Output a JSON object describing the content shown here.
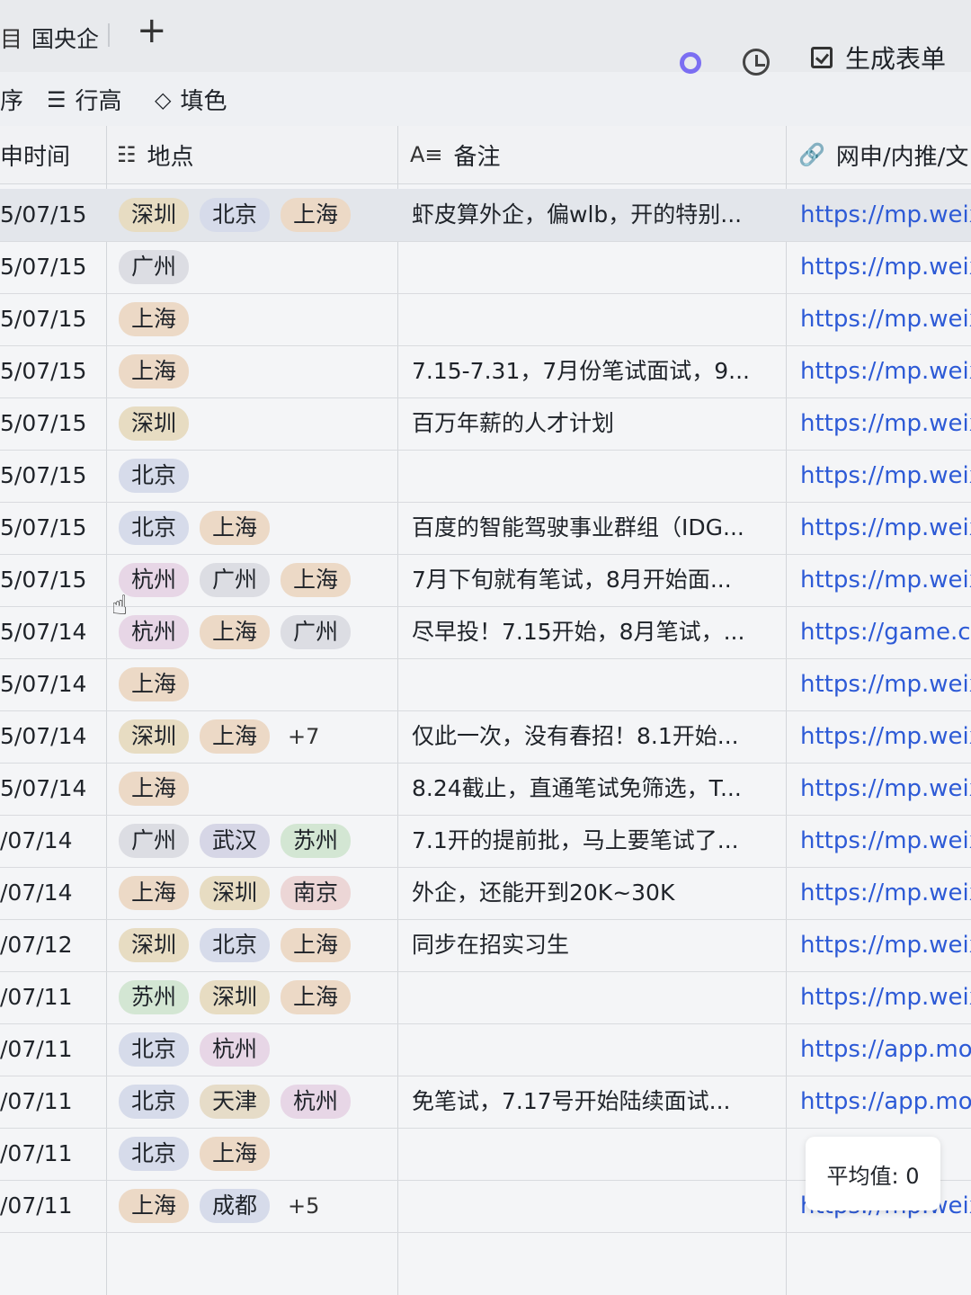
{
  "tabs": {
    "active": "国央企",
    "add": "+"
  },
  "toolbar": {
    "sort": "序",
    "row_height": "行高",
    "fill": "填色",
    "generate_form": "生成表单"
  },
  "columns": {
    "date": "申时间",
    "location": "地点",
    "note": "备注",
    "link": "网申/内推/文"
  },
  "tag_colors": {
    "深圳": "#e7dcc2",
    "北京": "#d6dbea",
    "上海": "#ecd9c6",
    "广州": "#dcdde3",
    "杭州": "#e7d6e6",
    "武汉": "#d6d6e6",
    "苏州": "#d3e6d3",
    "南京": "#ecd6d6",
    "天津": "#e6dcc8",
    "成都": "#d6dbea"
  },
  "rows": [
    {
      "date": "5/07/15",
      "tags": [
        "深圳",
        "北京",
        "上海"
      ],
      "more": "",
      "note": "虾皮算外企，偏wlb，开的特别...",
      "link": "https://mp.weixin"
    },
    {
      "date": "5/07/15",
      "tags": [
        "广州"
      ],
      "more": "",
      "note": "",
      "link": "https://mp.weixin"
    },
    {
      "date": "5/07/15",
      "tags": [
        "上海"
      ],
      "more": "",
      "note": "",
      "link": "https://mp.weixin"
    },
    {
      "date": "5/07/15",
      "tags": [
        "上海"
      ],
      "more": "",
      "note": "7.15-7.31，7月份笔试面试，9...",
      "link": "https://mp.weixin"
    },
    {
      "date": "5/07/15",
      "tags": [
        "深圳"
      ],
      "more": "",
      "note": "百万年薪的人才计划",
      "link": "https://mp.weixin"
    },
    {
      "date": "5/07/15",
      "tags": [
        "北京"
      ],
      "more": "",
      "note": "",
      "link": "https://mp.weixin"
    },
    {
      "date": "5/07/15",
      "tags": [
        "北京",
        "上海"
      ],
      "more": "",
      "note": "百度的智能驾驶事业群组（IDG...",
      "link": "https://mp.weixin"
    },
    {
      "date": "5/07/15",
      "tags": [
        "杭州",
        "广州",
        "上海"
      ],
      "more": "",
      "note": "7月下旬就有笔试，8月开始面...",
      "link": "https://mp.weixin"
    },
    {
      "date": "5/07/14",
      "tags": [
        "杭州",
        "上海",
        "广州"
      ],
      "more": "",
      "note": "尽早投！7.15开始，8月笔试，...",
      "link": "https://game.c"
    },
    {
      "date": "5/07/14",
      "tags": [
        "上海"
      ],
      "more": "",
      "note": "",
      "link": "https://mp.weixin"
    },
    {
      "date": "5/07/14",
      "tags": [
        "深圳",
        "上海"
      ],
      "more": "+7",
      "note": "仅此一次，没有春招！8.1开始...",
      "link": "https://mp.weixin"
    },
    {
      "date": "5/07/14",
      "tags": [
        "上海"
      ],
      "more": "",
      "note": "8.24截止，直通笔试免筛选，T...",
      "link": "https://mp.weixin"
    },
    {
      "date": "/07/14",
      "tags": [
        "广州",
        "武汉",
        "苏州"
      ],
      "more": "",
      "note": "7.1开的提前批，马上要笔试了...",
      "link": "https://mp.weixin"
    },
    {
      "date": "/07/14",
      "tags": [
        "上海",
        "深圳",
        "南京"
      ],
      "more": "",
      "note": "外企，还能开到20K~30K",
      "link": "https://mp.weixin"
    },
    {
      "date": "/07/12",
      "tags": [
        "深圳",
        "北京",
        "上海"
      ],
      "more": "",
      "note": "同步在招实习生",
      "link": "https://mp.weixin"
    },
    {
      "date": "/07/11",
      "tags": [
        "苏州",
        "深圳",
        "上海"
      ],
      "more": "",
      "note": "",
      "link": "https://mp.weixin"
    },
    {
      "date": "/07/11",
      "tags": [
        "北京",
        "杭州"
      ],
      "more": "",
      "note": "",
      "link": "https://app.mo"
    },
    {
      "date": "/07/11",
      "tags": [
        "北京",
        "天津",
        "杭州"
      ],
      "more": "",
      "note": "免笔试，7.17号开始陆续面试...",
      "link": "https://app.mo"
    },
    {
      "date": "/07/11",
      "tags": [
        "北京",
        "上海"
      ],
      "more": "",
      "note": "",
      "link": ""
    },
    {
      "date": "/07/11",
      "tags": [
        "上海",
        "成都"
      ],
      "more": "+5",
      "note": "",
      "link": "https://mp.weixin"
    }
  ],
  "footer": {
    "average": "平均值: 0"
  }
}
